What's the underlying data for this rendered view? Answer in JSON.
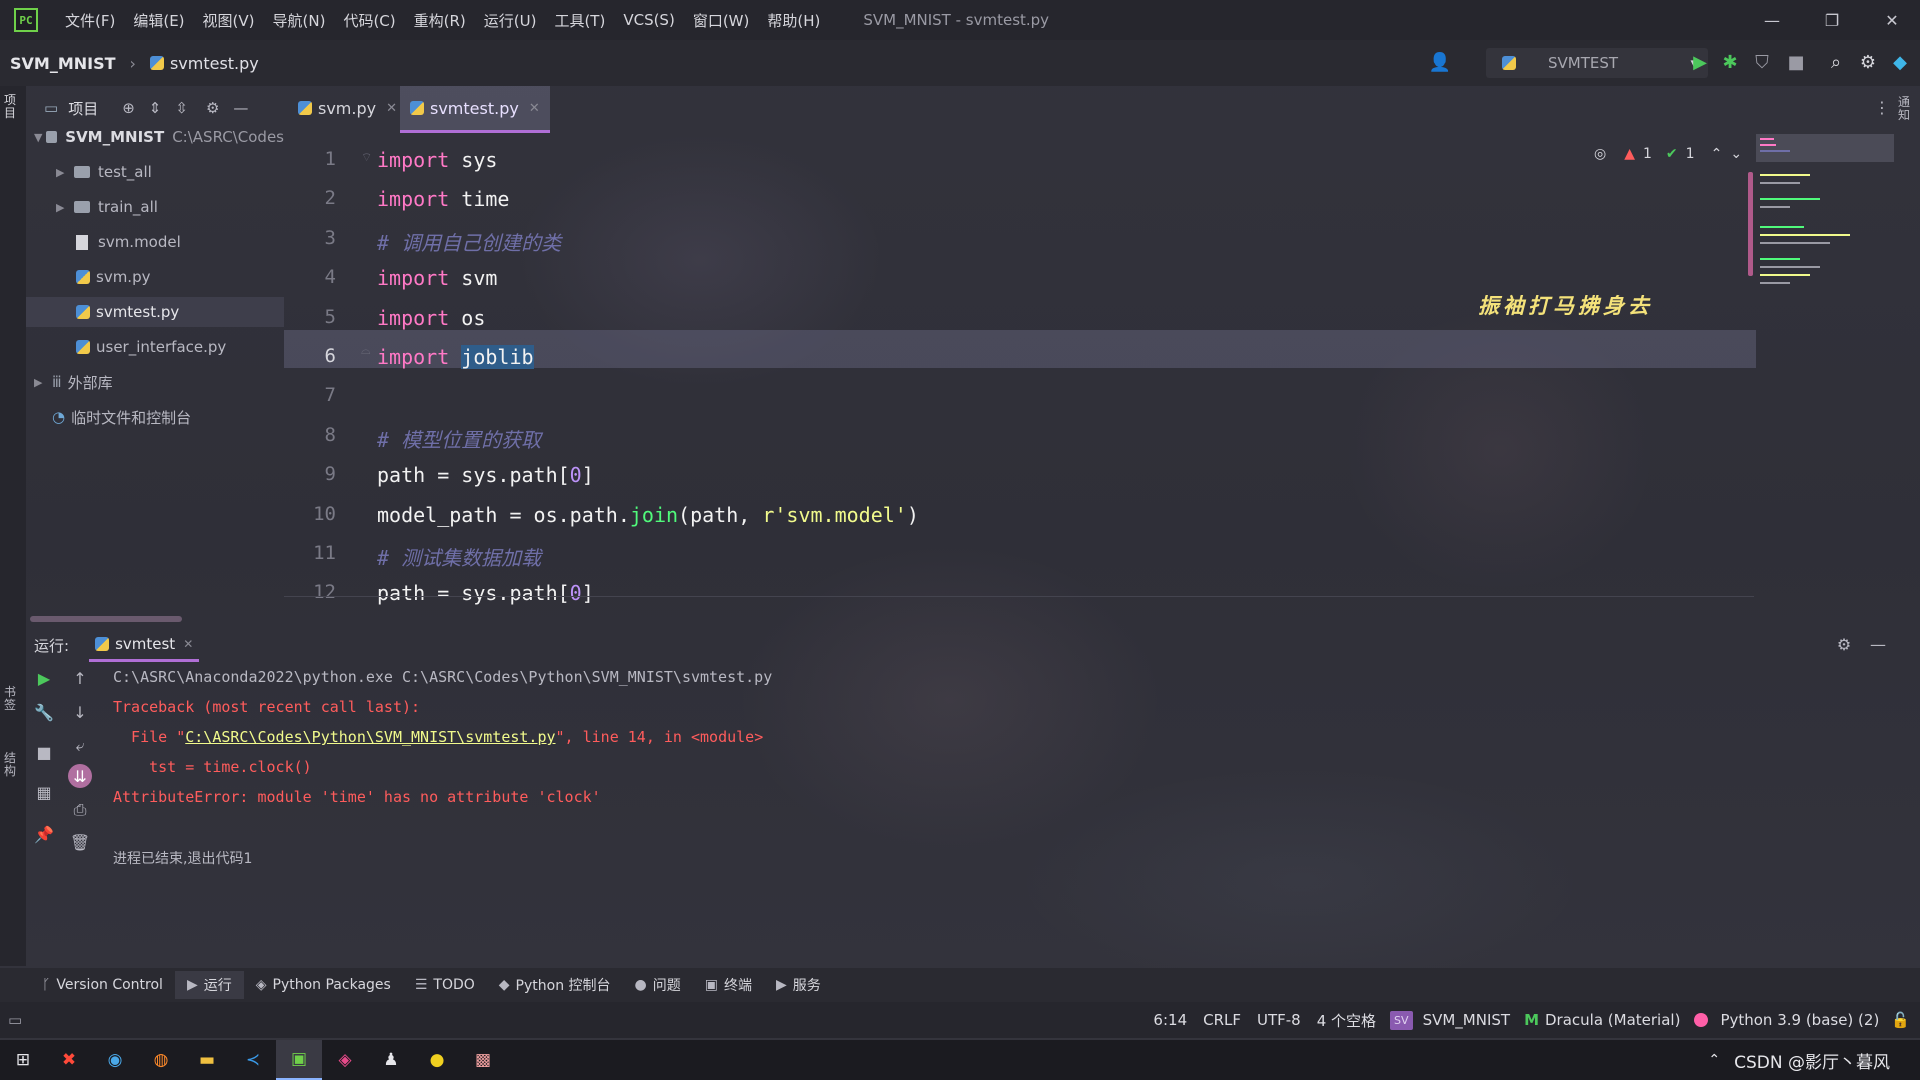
{
  "window": {
    "menus": [
      "文件(F)",
      "编辑(E)",
      "视图(V)",
      "导航(N)",
      "代码(C)",
      "重构(R)",
      "运行(U)",
      "工具(T)",
      "VCS(S)",
      "窗口(W)",
      "帮助(H)"
    ],
    "title": "SVM_MNIST - svmtest.py",
    "controls": {
      "minimize": "—",
      "restore": "❐",
      "close": "✕"
    }
  },
  "navbar": {
    "project": "SVM_MNIST",
    "file": "svmtest.py",
    "run_config": "SVMTEST"
  },
  "left_strip": {
    "project_label": "项目",
    "bookmarks_label": "书签",
    "structure_label": "结构"
  },
  "right_strip": {
    "notifications_label": "通知"
  },
  "project_panel": {
    "title": "项目",
    "root": {
      "name": "SVM_MNIST",
      "path": "C:\\ASRC\\Codes"
    },
    "items": [
      {
        "label": "test_all",
        "kind": "folder"
      },
      {
        "label": "train_all",
        "kind": "folder"
      },
      {
        "label": "svm.model",
        "kind": "file"
      },
      {
        "label": "svm.py",
        "kind": "python"
      },
      {
        "label": "svmtest.py",
        "kind": "python"
      },
      {
        "label": "user_interface.py",
        "kind": "python"
      }
    ],
    "external": "外部库",
    "scratches": "临时文件和控制台"
  },
  "tabs": [
    {
      "label": "svm.py"
    },
    {
      "label": "svmtest.py",
      "active": true
    }
  ],
  "inspections": {
    "warnings": "1",
    "ok": "1"
  },
  "editor": {
    "line_numbers": [
      "1",
      "2",
      "3",
      "4",
      "5",
      "6",
      "7",
      "8",
      "9",
      "10",
      "11",
      "12"
    ],
    "lines": [
      [
        {
          "t": "import",
          "c": "kw"
        },
        {
          "t": " sys"
        }
      ],
      [
        {
          "t": "import",
          "c": "kw"
        },
        {
          "t": " time"
        }
      ],
      [
        {
          "t": "# 调用自己创建的类",
          "c": "cm"
        }
      ],
      [
        {
          "t": "import",
          "c": "kw"
        },
        {
          "t": " svm"
        }
      ],
      [
        {
          "t": "import",
          "c": "kw"
        },
        {
          "t": " os"
        }
      ],
      [
        {
          "t": "import",
          "c": "kw"
        },
        {
          "t": " "
        },
        {
          "t": "joblib",
          "c": "sel"
        }
      ],
      [],
      [
        {
          "t": "# 模型位置的获取",
          "c": "cm"
        }
      ],
      [
        {
          "t": "path = sys.path["
        },
        {
          "t": "0",
          "c": "num"
        },
        {
          "t": "]"
        }
      ],
      [
        {
          "t": "model_path = os.path."
        },
        {
          "t": "join",
          "c": "fn"
        },
        {
          "t": "(path, "
        },
        {
          "t": "r'svm.model'",
          "c": "str"
        },
        {
          "t": ")"
        }
      ],
      [
        {
          "t": "# 测试集数据加载",
          "c": "cm"
        }
      ],
      [
        {
          "t": "path = sys.path["
        },
        {
          "t": "0",
          "c": "num"
        },
        {
          "t": "]"
        }
      ]
    ],
    "current_line": 6,
    "overlay_quote": "振袖打马拂身去"
  },
  "run_panel": {
    "label": "运行:",
    "tab": "svmtest",
    "console": {
      "cmd": "C:\\ASRC\\Anaconda2022\\python.exe C:\\ASRC\\Codes\\Python\\SVM_MNIST\\svmtest.py",
      "traceback": "Traceback (most recent call last):",
      "file_prefix": "  File \"",
      "file_link": "C:\\ASRC\\Codes\\Python\\SVM_MNIST\\svmtest.py",
      "file_suffix": "\", line 14, in <module>",
      "code_line": "    tst = time.clock()",
      "error": "AttributeError: module 'time' has no attribute 'clock'",
      "exit": "进程已结束,退出代码1"
    }
  },
  "tool_windows": [
    {
      "label": "Version Control",
      "icon": "ᚴ"
    },
    {
      "label": "运行",
      "icon": "▶",
      "active": true
    },
    {
      "label": "Python Packages",
      "icon": "◈"
    },
    {
      "label": "TODO",
      "icon": "☰"
    },
    {
      "label": "Python 控制台",
      "icon": "◆"
    },
    {
      "label": "问题",
      "icon": "●"
    },
    {
      "label": "终端",
      "icon": "▣"
    },
    {
      "label": "服务",
      "icon": "▶"
    }
  ],
  "status": {
    "position": "6:14",
    "line_sep": "CRLF",
    "encoding": "UTF-8",
    "indent": "4 个空格",
    "vcs_badge": "SV",
    "project": "SVM_MNIST",
    "theme": "Dracula (Material)",
    "interpreter": "Python 3.9 (base) (2)"
  },
  "taskbar": {
    "tray_text": "CSDN @影厅丶暮风"
  },
  "colors": {
    "keyword": "#ff79c6",
    "comment": "#6f6fa8",
    "number": "#bd93f9",
    "string": "#f1fa8c",
    "function": "#50fa7b",
    "error": "#ff5c5c",
    "quote": "#f4e27a"
  }
}
